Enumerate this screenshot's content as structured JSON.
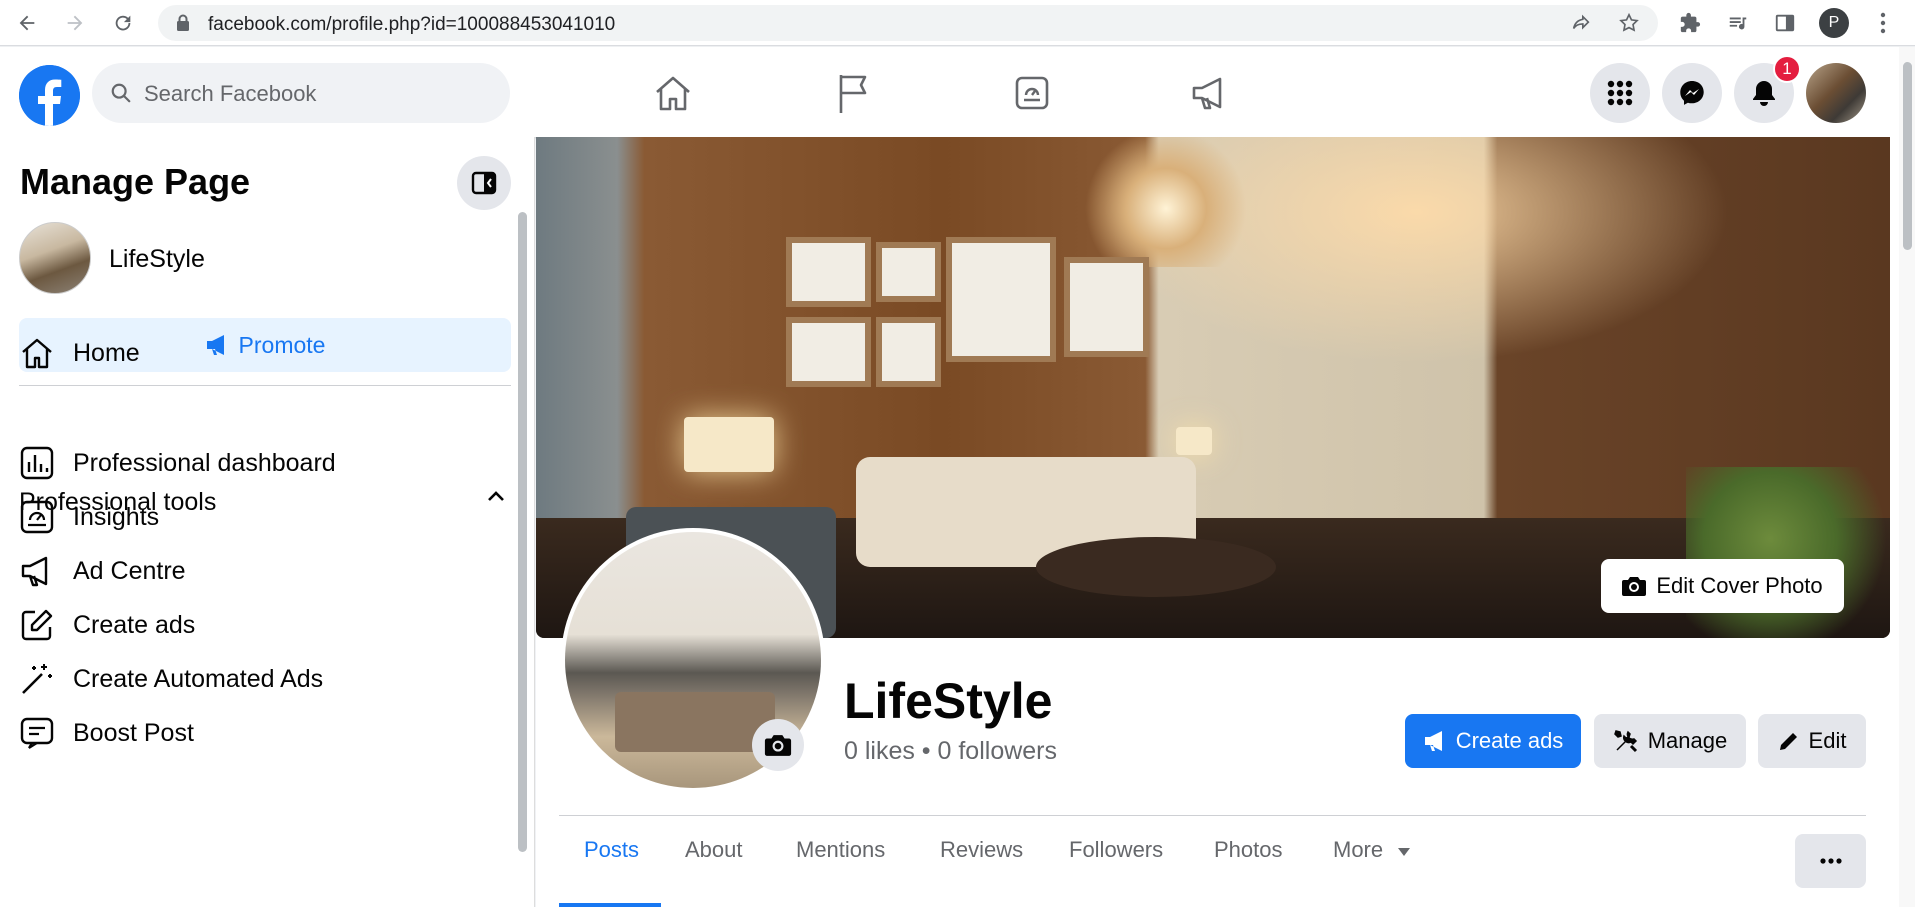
{
  "browser": {
    "url": "facebook.com/profile.php?id=100088453041010",
    "profile_initial": "P"
  },
  "header": {
    "search_placeholder": "Search Facebook",
    "notification_count": "1"
  },
  "sidebar": {
    "title": "Manage Page",
    "page_name": "LifeStyle",
    "promote_label": "Promote",
    "home_label": "Home",
    "section_title": "Professional tools",
    "items": [
      {
        "label": "Professional dashboard",
        "icon": "dashboard-icon"
      },
      {
        "label": "Insights",
        "icon": "insights-icon"
      },
      {
        "label": "Ad Centre",
        "icon": "megaphone-icon"
      },
      {
        "label": "Create ads",
        "icon": "edit-square-icon"
      },
      {
        "label": "Create Automated Ads",
        "icon": "magic-wand-icon"
      },
      {
        "label": "Boost Post",
        "icon": "boost-icon"
      }
    ]
  },
  "profile": {
    "name": "LifeStyle",
    "stats": "0 likes • 0 followers",
    "edit_cover_label": "Edit Cover Photo",
    "create_ads_label": "Create ads",
    "manage_label": "Manage",
    "edit_label": "Edit"
  },
  "tabs": [
    {
      "label": "Posts",
      "active": true
    },
    {
      "label": "About"
    },
    {
      "label": "Mentions"
    },
    {
      "label": "Reviews"
    },
    {
      "label": "Followers"
    },
    {
      "label": "Photos"
    },
    {
      "label": "More"
    }
  ],
  "colors": {
    "brand": "#1877f2",
    "badge": "#e41e3f"
  }
}
